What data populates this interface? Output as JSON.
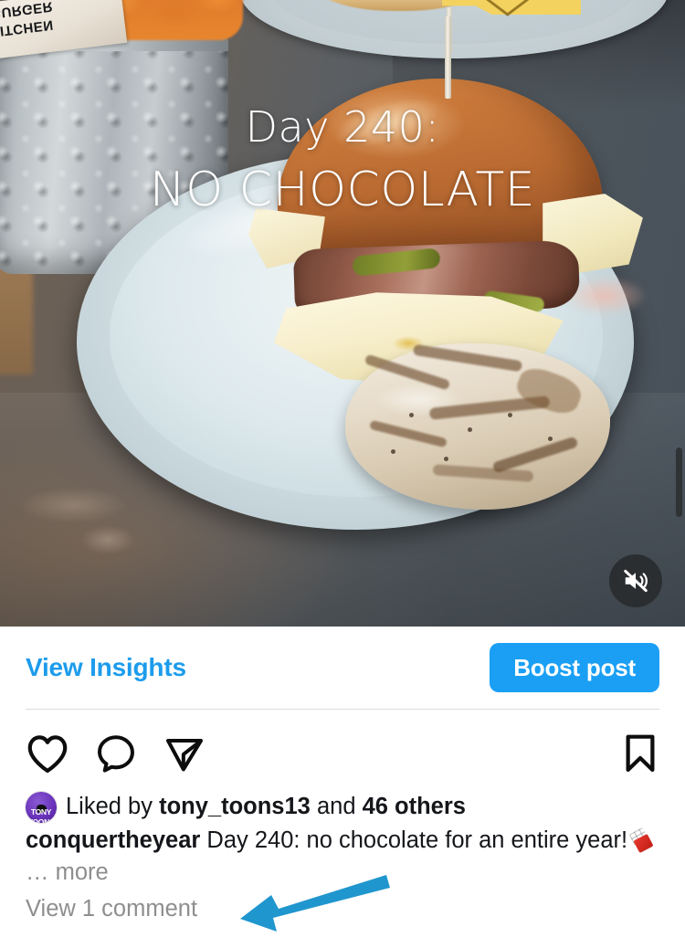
{
  "post": {
    "media": {
      "type": "video",
      "overlay_line_1": "Day 240:",
      "overlay_line_2": "NO CHOCOLATE",
      "mute_icon": "speaker-muted-icon",
      "scene_description": "Grilled chicken burger with cheese and bacon on a pale blue plate, metal cup of sweet potato fries at left, second plated burger with yellow flag at top",
      "wrapper_text_line_1": "BURGER",
      "wrapper_text_line_2": "KITCHEN"
    },
    "insights": {
      "view_insights_label": "View Insights",
      "boost_label": "Boost post",
      "accent_color": "#1a9ff5",
      "link_color": "#1c9cec"
    },
    "actions": {
      "like_icon": "heart-icon",
      "comment_icon": "comment-bubble-icon",
      "share_icon": "paper-plane-icon",
      "save_icon": "bookmark-icon"
    },
    "likes": {
      "prefix": "Liked by",
      "liker_username": "tony_toons13",
      "conjunction": "and",
      "others_count": "46 others",
      "avatar_line_1": "TONY",
      "avatar_line_2": "TOONS",
      "avatar_color": "#6a33ba"
    },
    "caption": {
      "username": "conquertheyear",
      "text": "Day 240: no chocolate for an entire year!",
      "emoji": "chocolate-bar-emoji",
      "ellipsis": "…",
      "more_label": "more"
    },
    "comments": {
      "view_comments_label": "View 1 comment",
      "muted_color": "#8e8e8e"
    },
    "annotation": {
      "type": "arrow",
      "color": "#2096ce",
      "points_to": "View 1 comment"
    }
  }
}
